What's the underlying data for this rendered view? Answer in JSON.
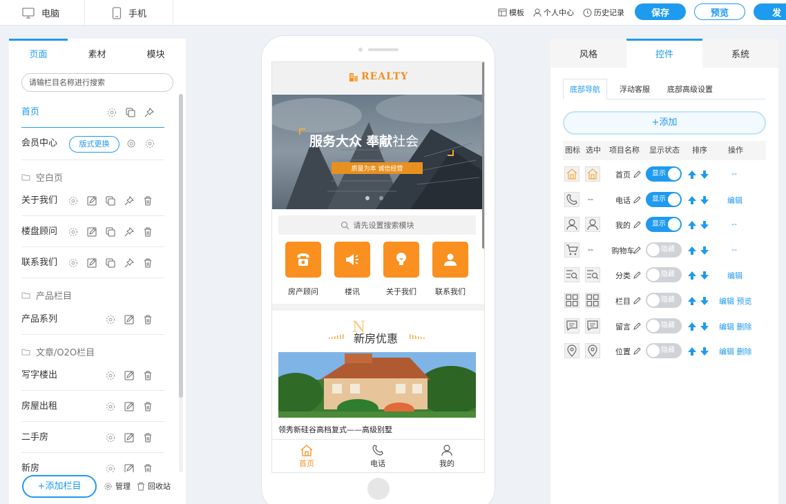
{
  "topbar": {
    "desktop": "电脑",
    "mobile": "手机",
    "links": [
      "模板",
      "个人中心",
      "历史记录"
    ],
    "save": "保存",
    "preview": "预览",
    "publish": "发"
  },
  "left": {
    "tabs": [
      "页面",
      "素材",
      "模块"
    ],
    "search_placeholder": "请输栏目名称进行搜索",
    "home": "首页",
    "member": "会员中心",
    "style_change": "版式更换",
    "group1": "空白页",
    "about": "关于我们",
    "loupan": "楼盘顾问",
    "contact": "联系我们",
    "group2": "产品栏目",
    "product_series": "产品系列",
    "group3": "文章/O2O栏目",
    "office": "写字楼出",
    "rent": "房屋出租",
    "second": "二手房",
    "newhouse": "新房",
    "add_column": "+添加栏目",
    "manage": "管理",
    "recycle": "回收站"
  },
  "phone": {
    "logo": "REALTY",
    "banner_title_a": "服务大众",
    "banner_title_b": "奉献",
    "banner_title_c": "社会",
    "banner_sub": "质量为本  诚信经营",
    "search": "请先设置搜索模块",
    "quick": [
      "房产顾问",
      "楼讯",
      "关于我们",
      "联系我们"
    ],
    "section_title": "新房优惠",
    "section_letter": "N",
    "house_caption": "领秀新硅谷高档复式——高级别墅",
    "nav": [
      "首页",
      "电话",
      "我的"
    ]
  },
  "right": {
    "tabs": [
      "风格",
      "控件",
      "系统"
    ],
    "subtabs": [
      "底部导航",
      "浮动客服",
      "底部高级设置"
    ],
    "add": "+添加",
    "headers": [
      "图标",
      "选中",
      "项目名称",
      "显示状态",
      "排序",
      "操作"
    ],
    "show": "显示",
    "hide": "隐藏",
    "rows": [
      {
        "name": "首页",
        "sel": "",
        "on": true,
        "ops": "--",
        "icon": "home-icon"
      },
      {
        "name": "电话",
        "sel": "--",
        "on": true,
        "ops": "编辑",
        "icon": "phone-icon"
      },
      {
        "name": "我的",
        "sel": "",
        "on": true,
        "ops": "--",
        "icon": "user-icon"
      },
      {
        "name": "购物车",
        "sel": "--",
        "on": false,
        "ops": "--",
        "icon": "cart-icon"
      },
      {
        "name": "分类",
        "sel": "",
        "on": false,
        "ops": "编辑",
        "icon": "category-icon"
      },
      {
        "name": "栏目",
        "sel": "",
        "on": false,
        "ops": "编辑 预览",
        "icon": "grid-icon"
      },
      {
        "name": "留言",
        "sel": "",
        "on": false,
        "ops": "编辑 删除",
        "icon": "message-icon"
      },
      {
        "name": "位置",
        "sel": "",
        "on": false,
        "ops": "编辑 删除",
        "icon": "location-icon"
      }
    ]
  },
  "colors": {
    "accent": "#1e9aef",
    "orange": "#f9901f"
  }
}
